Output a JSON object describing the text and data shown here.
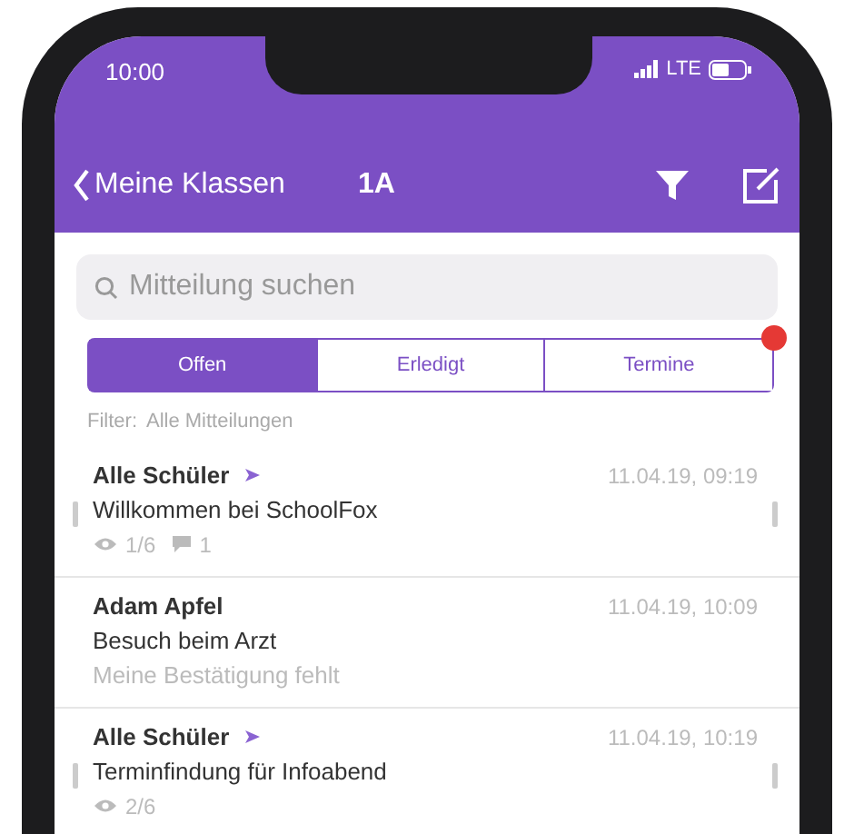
{
  "status_bar": {
    "time": "10:00",
    "network": "LTE"
  },
  "nav": {
    "back_label": "Meine Klassen",
    "title": "1A"
  },
  "search": {
    "placeholder": "Mitteilung suchen"
  },
  "tabs": [
    {
      "label": "Offen",
      "selected": true,
      "notification_dot": false
    },
    {
      "label": "Erledigt",
      "selected": false,
      "notification_dot": false
    },
    {
      "label": "Termine",
      "selected": false,
      "notification_dot": true
    }
  ],
  "filter": {
    "label": "Filter:",
    "value": "Alle Mitteilungen"
  },
  "messages": [
    {
      "kind": "stats",
      "sender": "Alle Schüler",
      "sent_to_group": true,
      "time": "11.04.19, 09:19",
      "subject": "Willkommen bei SchoolFox",
      "views": "1/6",
      "comments": "1",
      "swipe_hints": true
    },
    {
      "kind": "note",
      "sender": "Adam Apfel",
      "sent_to_group": false,
      "time": "11.04.19, 10:09",
      "subject": "Besuch beim Arzt",
      "note": "Meine Bestätigung fehlt",
      "swipe_hints": false
    },
    {
      "kind": "stats",
      "sender": "Alle Schüler",
      "sent_to_group": true,
      "time": "11.04.19, 10:19",
      "subject": "Terminfindung für Infoabend",
      "views": "2/6",
      "swipe_hints": true
    }
  ]
}
